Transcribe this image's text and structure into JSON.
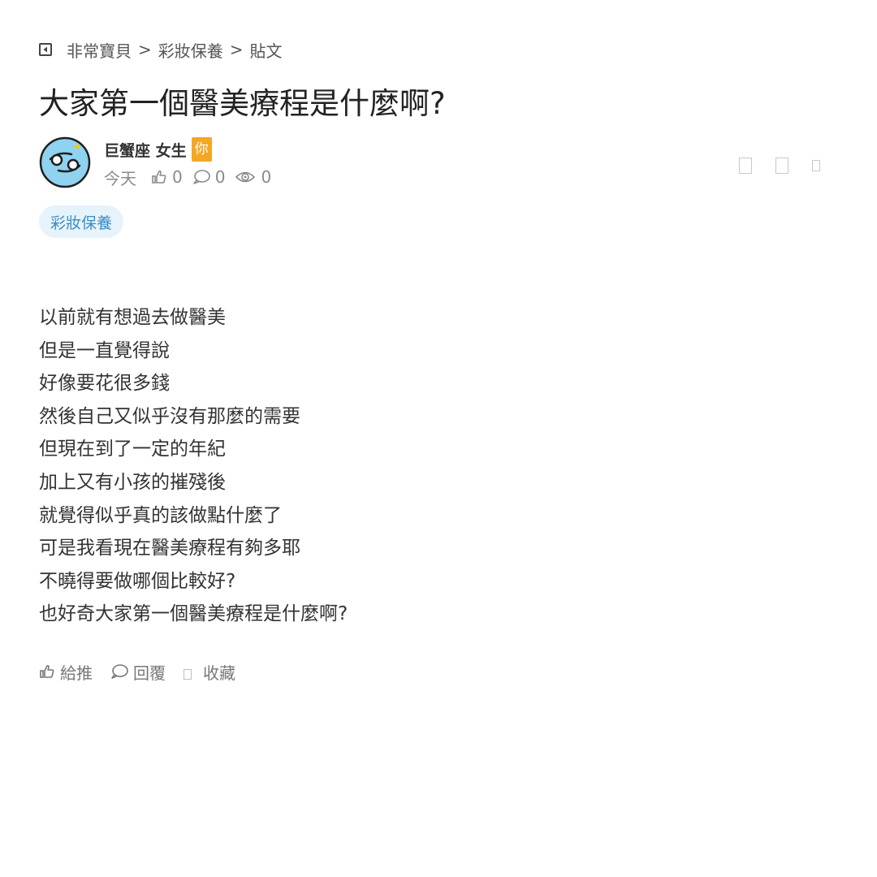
{
  "breadcrumb": {
    "items": [
      "非常寶貝",
      "彩妝保養",
      "貼文"
    ],
    "separator": ">"
  },
  "post": {
    "title": "大家第一個醫美療程是什麼啊?",
    "author": {
      "name": "巨蟹座 女生",
      "badge": "你",
      "avatar_icon": "cancer-zodiac-icon"
    },
    "meta": {
      "date": "今天",
      "likes": "0",
      "comments": "0",
      "views": "0"
    },
    "tag": "彩妝保養",
    "body_lines": [
      "以前就有想過去做醫美",
      "但是一直覺得說",
      "好像要花很多錢",
      "然後自己又似乎沒有那麼的需要",
      "但現在到了一定的年紀",
      "加上又有小孩的摧殘後",
      "就覺得似乎真的該做點什麼了",
      "可是我看現在醫美療程有夠多耶",
      "不曉得要做哪個比較好?",
      "也好奇大家第一個醫美療程是什麼啊?"
    ]
  },
  "actions": {
    "like_label": "給推",
    "reply_label": "回覆",
    "favorite_label": "收藏"
  },
  "colors": {
    "badge": "#f5a623",
    "tag_bg": "#e6f3fb",
    "tag_text": "#3d8ec1",
    "avatar_bg": "#8fd3f0"
  }
}
